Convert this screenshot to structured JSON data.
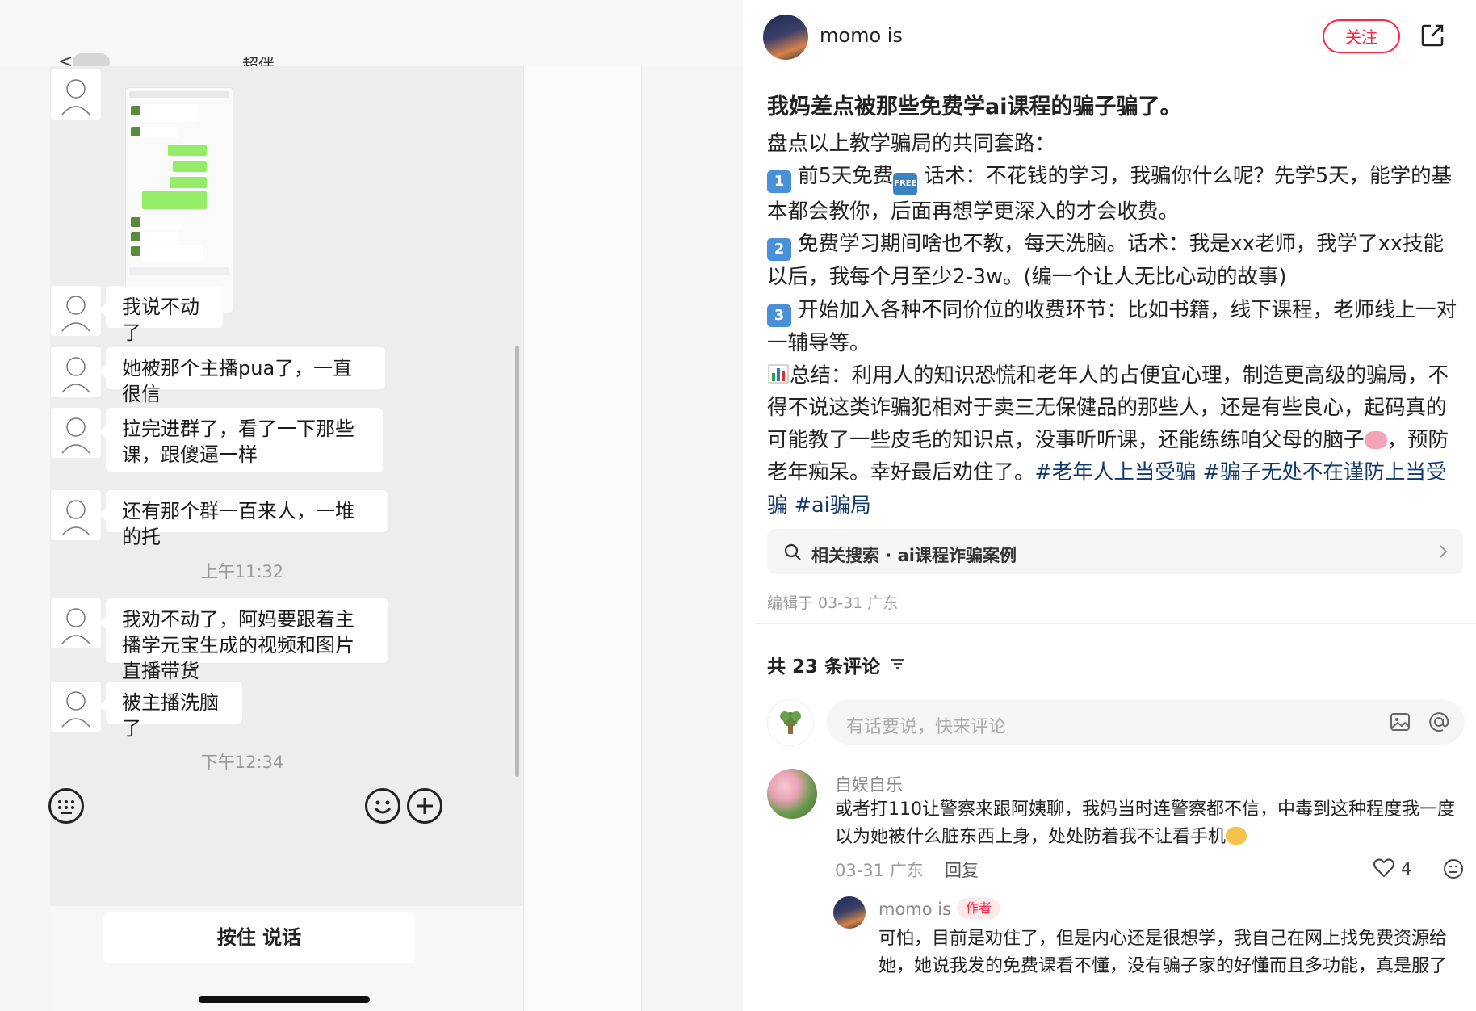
{
  "chat": {
    "back_label": "<",
    "title": "超伴",
    "messages": [
      {
        "text": "我说不动了"
      },
      {
        "text": "她被那个主播pua了，一直很信"
      },
      {
        "text": "拉完进群了，看了一下那些课，跟傻逼一样"
      },
      {
        "text": "还有那个群一百来人，一堆的托"
      },
      {
        "text": "我劝不动了，阿妈要跟着主播学元宝生成的视频和图片直播带货"
      },
      {
        "text": "被主播洗脑了"
      }
    ],
    "time_1": "上午11:32",
    "time_2": "下午12:34",
    "voice_button_label": "按住 说话"
  },
  "post": {
    "author_name": "momo is",
    "follow_label": "关注",
    "title": "我妈差点被那些免费学ai课程的骗子骗了。",
    "intro": "盘点以上教学骗局的共同套路：",
    "point1_a": "前5天免费",
    "point1_badge": "FREE",
    "point1_b": "话术：不花钱的学习，我骗你什么呢？先学5天，能学的基本都会教你，后面再想学更深入的才会收费。",
    "point2": "免费学习期间啥也不教，每天洗脑。话术：我是xx老师，我学了xx技能以后，我每个月至少2-3w。(编一个让人无比心动的故事)",
    "point3": "开始加入各种不同价位的收费环节：比如书籍，线下课程，老师线上一对一辅导等。",
    "summary_a": "总结：利用人的知识恐慌和老年人的占便宜心理，制造更高级的骗局，不得不说这类诈骗犯相对于卖三无保健品的那些人，还是有些良心，起码真的可能教了一些皮毛的知识点，没事听听课，还能练练咱父母的脑子",
    "summary_b": "，预防老年痴呆。幸好最后劝住了。",
    "hashtags": [
      "#老年人上当受骗",
      "#骗子无处不在谨防上当受骗",
      "#ai骗局"
    ],
    "related_search": "相关搜索 · ai课程诈骗案例",
    "edit_info": "编辑于 03-31 广东"
  },
  "comments": {
    "count_label": "共 23 条评论",
    "input_placeholder": "有话要说，快来评论",
    "items": [
      {
        "name": "自娱自乐",
        "text": "或者打110让警察来跟阿姨聊，我妈当时连警察都不信，中毒到这种程度我一度以为她被什么脏东西上身，处处防着我不让看手机",
        "meta": "03-31 广东",
        "reply_label": "回复",
        "likes": "4"
      },
      {
        "name": "momo is",
        "tag": "作者",
        "text": "可怕，目前是劝住了，但是内心还是很想学，我自己在网上找免费资源给她，她说我发的免费课看不懂，没有骗子家的好懂而且多功能，真是服了"
      }
    ]
  },
  "colors": {
    "accent": "#ff2442",
    "hashtag": "#13386c",
    "wechat_green": "#95ec69"
  }
}
